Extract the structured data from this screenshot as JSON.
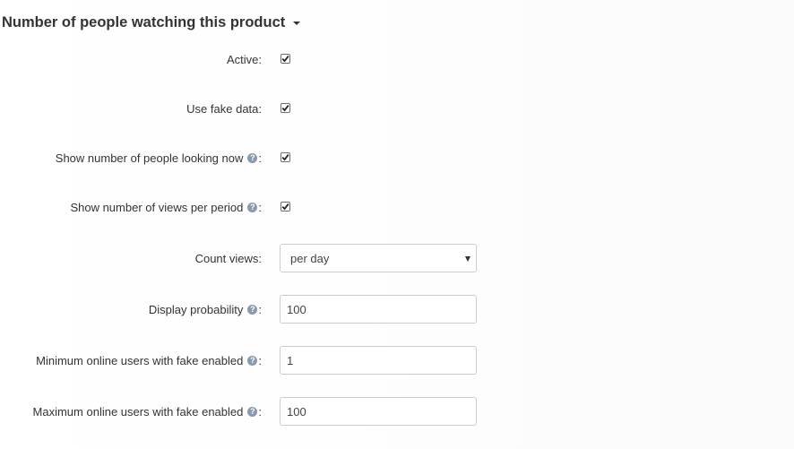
{
  "section": {
    "title": "Number of people watching this product",
    "collapse_icon": "caret-down-icon"
  },
  "fields": {
    "active": {
      "label": "Active:",
      "checked": true
    },
    "use_fake": {
      "label": "Use fake data:",
      "checked": true
    },
    "show_looking": {
      "label": "Show number of people looking now",
      "suffix": ":",
      "checked": true,
      "help_icon": "question-circle-icon",
      "help_glyph": "?"
    },
    "show_views": {
      "label": "Show number of views per period",
      "suffix": ":",
      "checked": true,
      "help_icon": "question-circle-icon",
      "help_glyph": "?"
    },
    "count_views": {
      "label": "Count views:",
      "value": "per day"
    },
    "display_probability": {
      "label": "Display probability",
      "suffix": ":",
      "value": "100",
      "help_icon": "question-circle-icon",
      "help_glyph": "?"
    },
    "min_online": {
      "label": "Minimum online users with fake enabled",
      "suffix": ":",
      "value": "1",
      "help_icon": "question-circle-icon",
      "help_glyph": "?"
    },
    "max_online": {
      "label": "Maximum online users with fake enabled",
      "suffix": ":",
      "value": "100",
      "help_icon": "question-circle-icon",
      "help_glyph": "?"
    }
  }
}
